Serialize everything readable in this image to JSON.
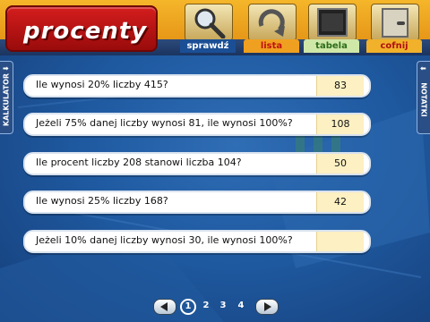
{
  "app": {
    "title": "procenty"
  },
  "toolbar": {
    "tabs": [
      {
        "label": "sprawdź",
        "icon": "magnifier-icon"
      },
      {
        "label": "lista",
        "icon": "refresh-arrow-icon"
      },
      {
        "label": "tabela",
        "icon": "board-icon"
      },
      {
        "label": "cofnij",
        "icon": "door-icon"
      }
    ]
  },
  "side_panels": {
    "left_label": "KALKULATOR",
    "right_label": "NOTATKI"
  },
  "questions": [
    {
      "text": "Ile wynosi 20% liczby 415?",
      "answer": "83"
    },
    {
      "text": "Jeżeli 75% danej liczby wynosi 81, ile wynosi 100%?",
      "answer": "108"
    },
    {
      "text": "Ile procent liczby 208 stanowi liczba 104?",
      "answer": "50"
    },
    {
      "text": "Ile wynosi 25% liczby 168?",
      "answer": "42"
    },
    {
      "text": "Jeżeli 10% danej liczby wynosi 30, ile wynosi 100%?",
      "answer": ""
    }
  ],
  "pagination": {
    "pages": [
      "1",
      "2",
      "3",
      "4"
    ],
    "current": "1"
  },
  "colors": {
    "header": "#f0a020",
    "title_plate": "#c81818",
    "background": "#1f5aa1",
    "answer_box": "#fdf0c2"
  }
}
